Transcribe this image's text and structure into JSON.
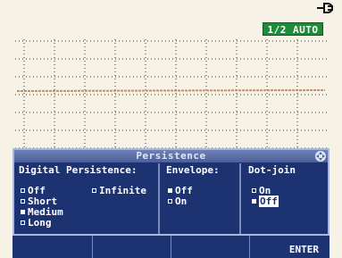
{
  "status": {
    "range_badge": "1/2 AUTO",
    "power_icon": "plug-icon"
  },
  "colors": {
    "trace": "#e39c6b",
    "panel_bg": "#1d3270",
    "badge_bg": "#1f8a3a"
  },
  "panel": {
    "title": "Persistence",
    "title_icon": "navigation-icon",
    "digital_persistence": {
      "header": "Digital Persistence:",
      "options": [
        {
          "label": "Off",
          "selected": false
        },
        {
          "label": "Infinite",
          "selected": false
        },
        {
          "label": "Short",
          "selected": false
        },
        {
          "label": "Medium",
          "selected": true
        },
        {
          "label": "Long",
          "selected": false
        }
      ]
    },
    "envelope": {
      "header": "Envelope:",
      "options": [
        {
          "label": "Off",
          "selected": true
        },
        {
          "label": "On",
          "selected": false
        }
      ]
    },
    "dot_join": {
      "header": "Dot-join",
      "options": [
        {
          "label": "On",
          "selected": false
        },
        {
          "label": "Off",
          "selected": true
        }
      ]
    }
  },
  "softkeys": [
    "",
    "",
    "",
    "ENTER"
  ]
}
